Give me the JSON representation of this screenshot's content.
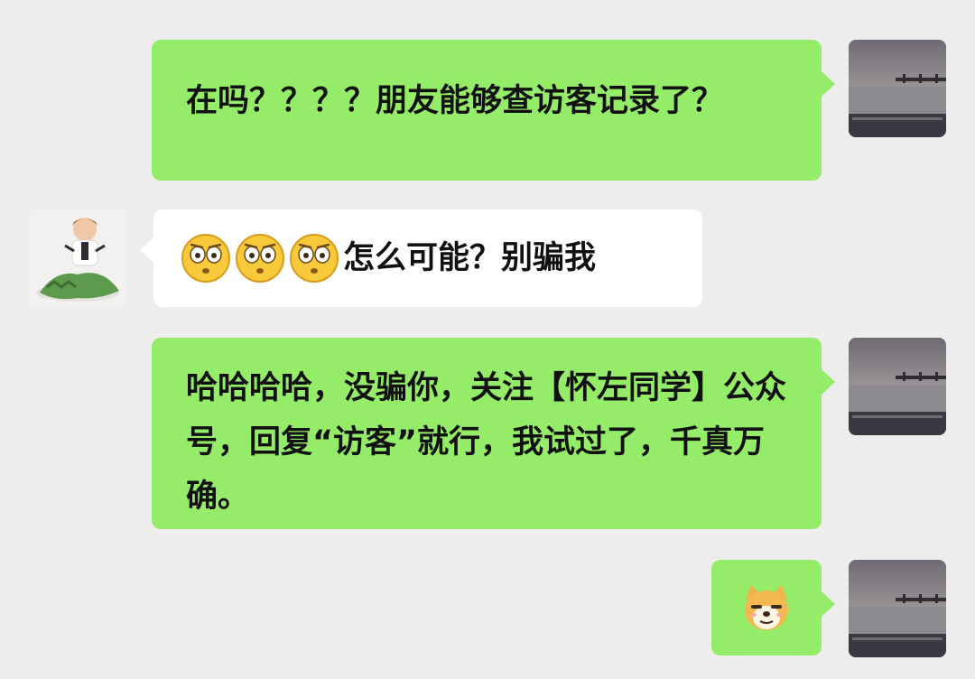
{
  "messages": [
    {
      "sender": "me",
      "text": "在吗？？？？朋友能够查访客记录了？"
    },
    {
      "sender": "other",
      "emoji": [
        "flushed-face",
        "flushed-face",
        "flushed-face"
      ],
      "text": "怎么可能？别骗我"
    },
    {
      "sender": "me",
      "text": "哈哈哈哈，没骗你，关注【怀左同学】公众号，回复“访客”就行，我试过了，千真万确。"
    },
    {
      "sender": "me",
      "sticker": "doge-face"
    }
  ],
  "colors": {
    "background": "#ededed",
    "my_bubble": "#95ec69",
    "their_bubble": "#ffffff"
  }
}
